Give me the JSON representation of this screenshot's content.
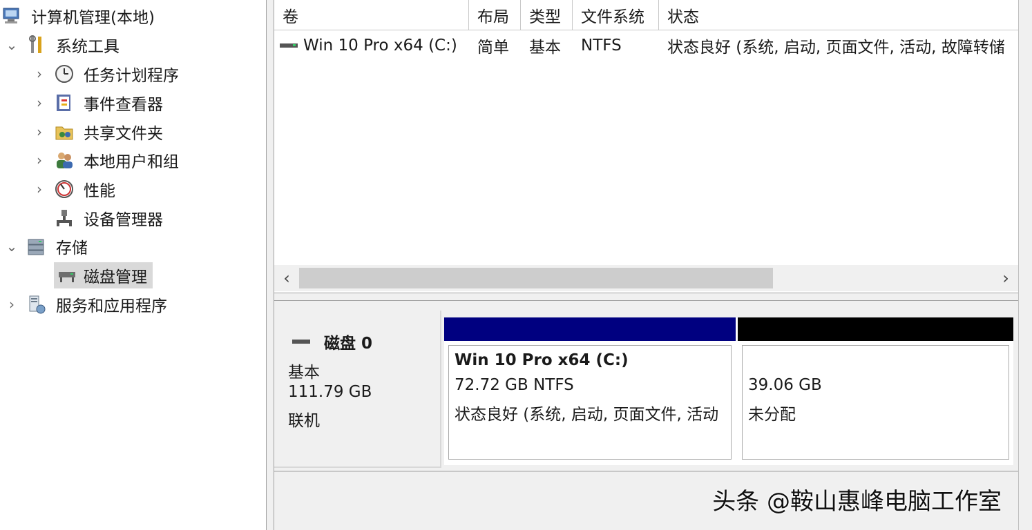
{
  "tree": {
    "root": "计算机管理(本地)",
    "system_tools": "系统工具",
    "task_scheduler": "任务计划程序",
    "event_viewer": "事件查看器",
    "shared_folders": "共享文件夹",
    "local_users": "本地用户和组",
    "performance": "性能",
    "device_manager": "设备管理器",
    "storage": "存储",
    "disk_management": "磁盘管理",
    "services_apps": "服务和应用程序"
  },
  "volumes": {
    "headers": [
      "卷",
      "布局",
      "类型",
      "文件系统",
      "状态"
    ],
    "rows": [
      {
        "volume": "Win 10 Pro x64 (C:)",
        "layout": "简单",
        "type": "基本",
        "fs": "NTFS",
        "status": "状态良好 (系统, 启动, 页面文件, 活动, 故障转储"
      }
    ]
  },
  "disk": {
    "name": "磁盘 0",
    "kind": "基本",
    "size": "111.79 GB",
    "state": "联机",
    "partitions": [
      {
        "title": "Win 10 Pro x64  (C:)",
        "line1": "72.72 GB NTFS",
        "line2": "状态良好 (系统, 启动, 页面文件, 活动",
        "color": "#000080"
      },
      {
        "title": "",
        "line1": "39.06 GB",
        "line2": "未分配",
        "color": "#000000"
      }
    ]
  },
  "watermark": "头条 @鞍山惠峰电脑工作室",
  "scroll": {
    "left": "‹",
    "right": "›"
  }
}
